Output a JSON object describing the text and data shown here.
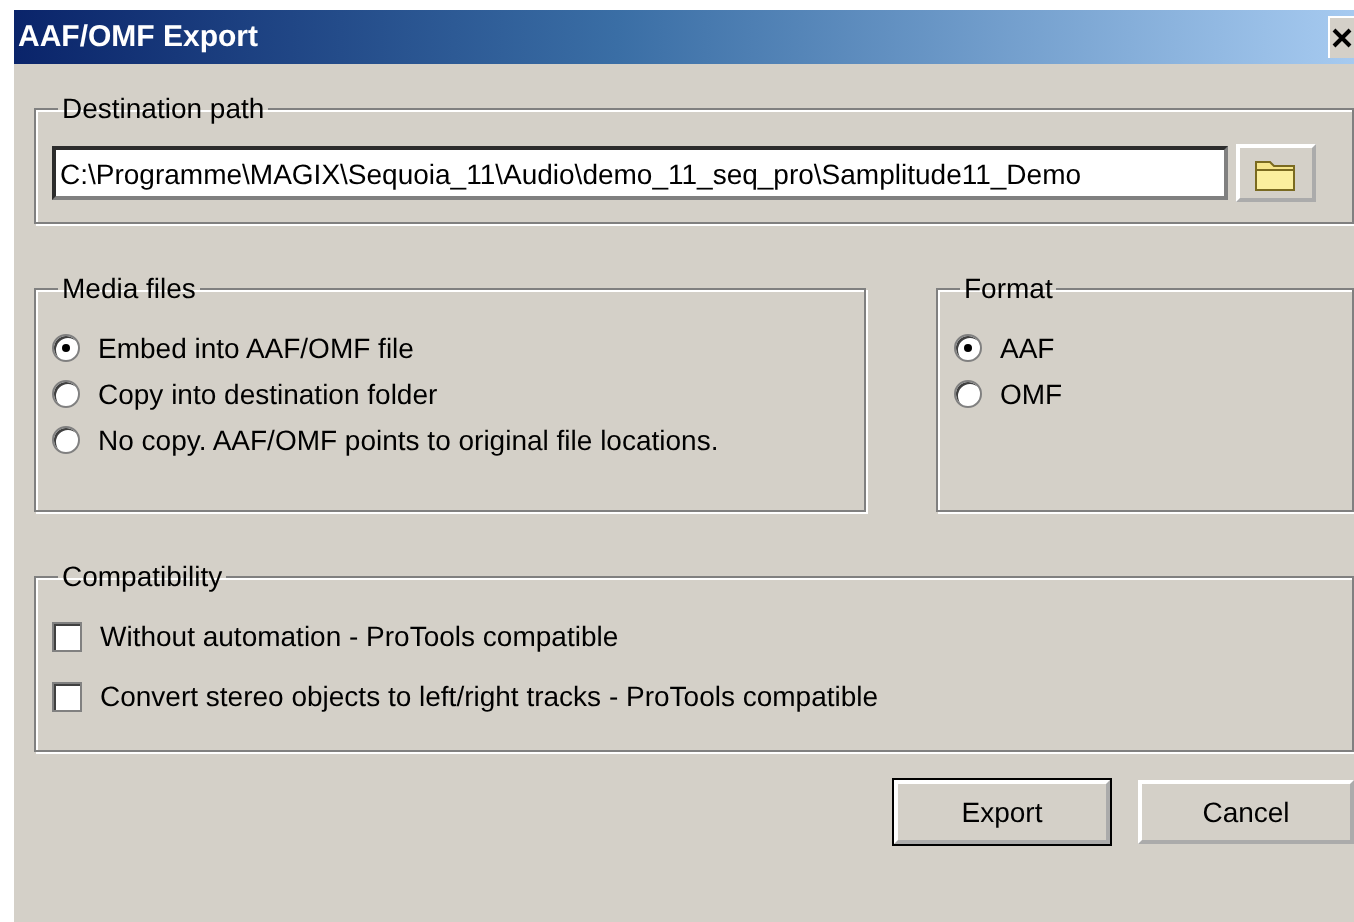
{
  "window": {
    "title": "AAF/OMF Export"
  },
  "destination": {
    "legend": "Destination path",
    "value": "C:\\Programme\\MAGIX\\Sequoia_11\\Audio\\demo_11_seq_pro\\Samplitude11_Demo"
  },
  "media_files": {
    "legend": "Media files",
    "options": [
      {
        "label": "Embed into AAF/OMF file",
        "selected": true
      },
      {
        "label": "Copy into destination folder",
        "selected": false
      },
      {
        "label": "No copy. AAF/OMF points to original file locations.",
        "selected": false
      }
    ]
  },
  "format": {
    "legend": "Format",
    "options": [
      {
        "label": "AAF",
        "selected": true
      },
      {
        "label": "OMF",
        "selected": false
      }
    ]
  },
  "compatibility": {
    "legend": "Compatibility",
    "options": [
      {
        "label": "Without automation - ProTools compatible",
        "checked": false
      },
      {
        "label": "Convert stereo objects to left/right tracks - ProTools compatible",
        "checked": false
      }
    ]
  },
  "buttons": [
    {
      "label": "Export",
      "default": true
    },
    {
      "label": "Cancel",
      "default": false
    }
  ]
}
